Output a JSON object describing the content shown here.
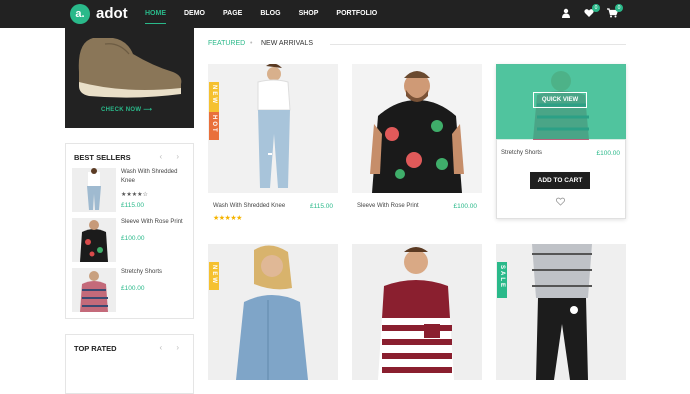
{
  "brand": {
    "mark": "a.",
    "name": "adot"
  },
  "nav": [
    "HOME",
    "DEMO",
    "PAGE",
    "BLOG",
    "SHOP",
    "PORTFOLIO"
  ],
  "header": {
    "wishlist_count": "0",
    "cart_count": "0"
  },
  "promo": {
    "cta": "CHECK NOW ⟶"
  },
  "best_sellers": {
    "title": "BEST SELLERS",
    "items": [
      {
        "name": "Wash With Shredded Knee",
        "price": "£115.00",
        "stars": "★★★★☆"
      },
      {
        "name": "Sleeve With Rose Print",
        "price": "£100.00"
      },
      {
        "name": "Stretchy Shorts",
        "price": "£100.00"
      }
    ]
  },
  "top_rated": {
    "title": "TOP RATED"
  },
  "tabs": {
    "featured": "FEATURED",
    "new_arrivals": "NEW ARRIVALS"
  },
  "products": [
    {
      "name": "Wash With Shredded Knee",
      "price": "£115.00",
      "stars": "★★★★★"
    },
    {
      "name": "Sleeve With Rose Print",
      "price": "£100.00"
    },
    {
      "name": "Stretchy Shorts",
      "price": "£100.00"
    }
  ],
  "ribbons": {
    "new": "NEW",
    "hot": "HOT",
    "sale": "SALE"
  },
  "actions": {
    "quick_view": "QUICK VIEW",
    "add_to_cart": "ADD TO CART"
  },
  "colors": {
    "accent": "#2ab98a",
    "header": "#222222",
    "new": "#f5c130",
    "hot": "#e9703b"
  }
}
